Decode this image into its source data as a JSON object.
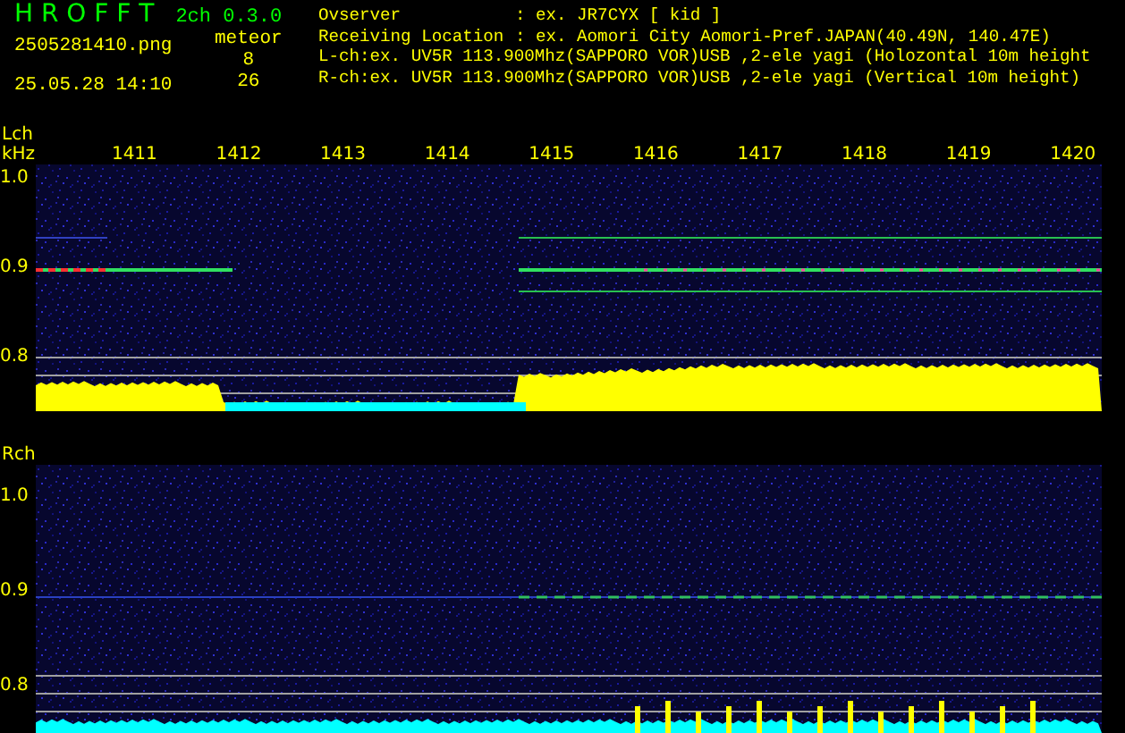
{
  "header": {
    "app_title": "H R O F F T",
    "version": "2ch 0.3.0",
    "filename": "2505281410.png",
    "datetime": "25.05.28 14:10",
    "meteor_label": "meteor",
    "meteor_counts": [
      "8",
      "26"
    ],
    "info_lines": [
      {
        "label": "Ovserver",
        "value": ": ex. JR7CYX [ kid ]"
      },
      {
        "label": "Receiving Location",
        "value": ": ex. Aomori City Aomori-Pref.JAPAN(40.49N, 140.47E)"
      },
      {
        "label": "L-ch:ex. UV5R 113.900Mhz(SAPPORO VOR)USB ,2-ele yagi (Holozontal 10m height"
      },
      {
        "label": "R-ch:ex. UV5R 113.900Mhz(SAPPORO VOR)USB ,2-ele yagi (Vertical 10m height)"
      }
    ]
  },
  "time_axis": [
    "1411",
    "1412",
    "1413",
    "1414",
    "1415",
    "1416",
    "1417",
    "1418",
    "1419",
    "1420"
  ],
  "panels": [
    {
      "channel": "Lch",
      "unit": "kHz",
      "y_labels": [
        "1.0",
        "0.9",
        "0.8"
      ]
    },
    {
      "channel": "Rch",
      "y_labels": [
        "1.0",
        "0.9",
        "0.8"
      ]
    }
  ]
}
